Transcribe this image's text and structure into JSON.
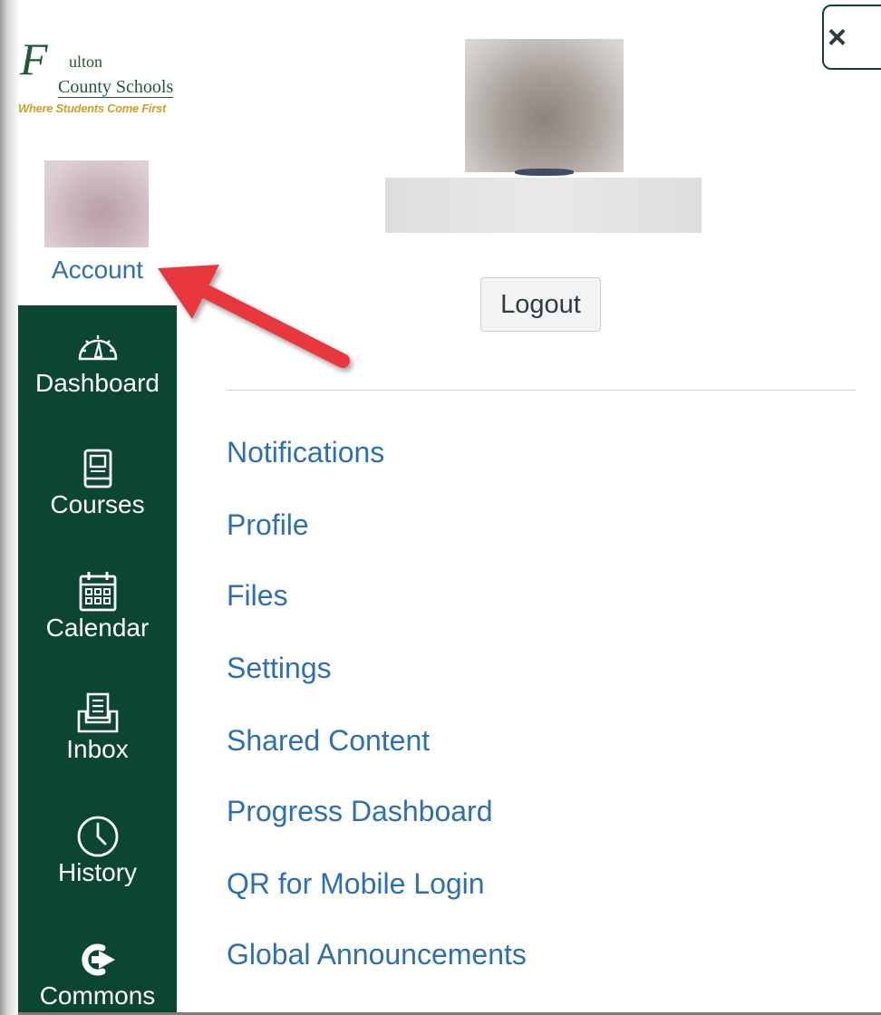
{
  "logo": {
    "script_initial": "F",
    "line1": "ulton",
    "line2": "County Schools",
    "tagline": "Where Students Come First"
  },
  "sidebar": {
    "account_label": "Account",
    "items": [
      {
        "label": "Dashboard",
        "icon": "dashboard-gauge-icon"
      },
      {
        "label": "Courses",
        "icon": "book-icon"
      },
      {
        "label": "Calendar",
        "icon": "calendar-icon"
      },
      {
        "label": "Inbox",
        "icon": "inbox-icon"
      },
      {
        "label": "History",
        "icon": "clock-icon"
      },
      {
        "label": "Commons",
        "icon": "commons-arrow-icon"
      }
    ]
  },
  "panel": {
    "close_label": "×",
    "logout_label": "Logout",
    "links": [
      "Notifications",
      "Profile",
      "Files",
      "Settings",
      "Shared Content",
      "Progress Dashboard",
      "QR for Mobile Login",
      "Global Announcements"
    ]
  },
  "colors": {
    "nav_background": "#0b4533",
    "link": "#2d6fb5",
    "annotation_arrow": "#e8383d",
    "logo_green": "#1d5a35",
    "logo_gold": "#c9a227"
  }
}
